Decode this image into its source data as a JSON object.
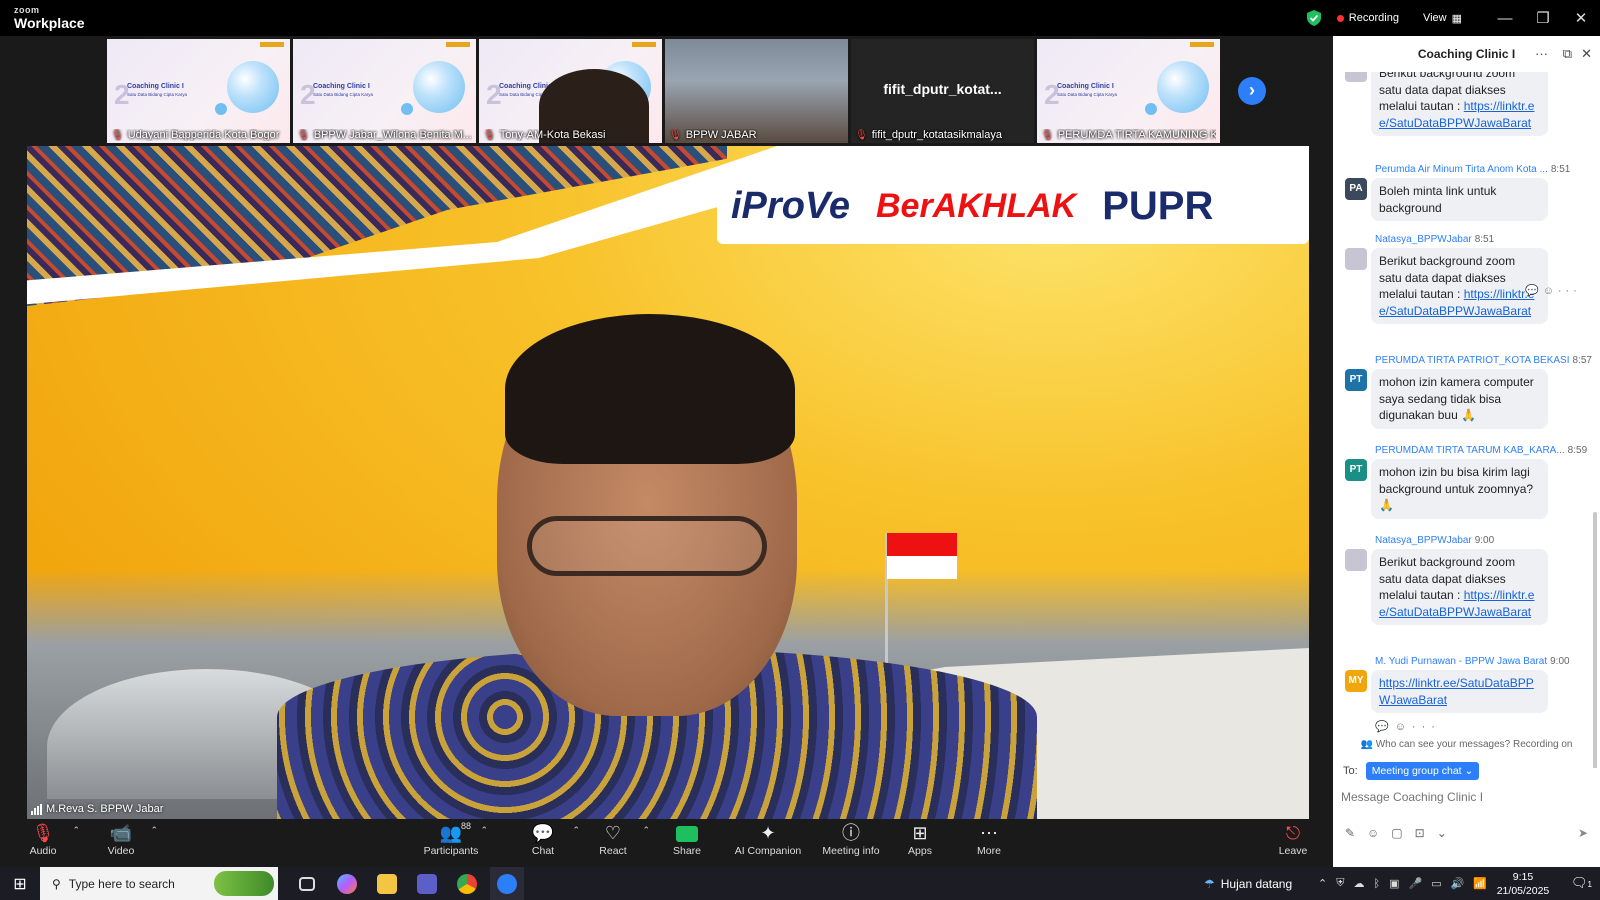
{
  "app": {
    "brand_top": "zoom",
    "brand": "Workplace",
    "recording_label": "Recording",
    "view_label": "View"
  },
  "thumbnails": [
    {
      "name": "Udayani Bapperida Kota Bogor",
      "type": "slide",
      "slide_title": "Coaching Clinic I",
      "slide_sub": "Satu Data Bidang Cipta Karya",
      "num": "2"
    },
    {
      "name": "BPPW Jabar_Wilona Benita M...",
      "type": "slide",
      "slide_title": "Coaching Clinic I",
      "slide_sub": "Satu Data Bidang Cipta Karya",
      "num": "2"
    },
    {
      "name": "Tony-AM-Kota Bekasi",
      "type": "person",
      "slide_title": "Coaching Clinic I",
      "slide_sub": "Satu Data Bidang Cipta Karya",
      "num": "2"
    },
    {
      "name": "BPPW JABAR",
      "type": "room"
    },
    {
      "name": "fifit_dputr_kotatasikmalaya",
      "type": "dark",
      "big": "fifit_dputr_kotat..."
    },
    {
      "name": "PERUMDA TIRTA KAMUNING KA...",
      "type": "slide",
      "slide_title": "Coaching Clinic I",
      "slide_sub": "Satu Data Bidang Cipta Karya",
      "num": "2"
    }
  ],
  "main_video": {
    "speaker_name": "M.Reva S. BPPW Jabar",
    "logo1": "iProVe",
    "logo2": "BerAKHLAK",
    "logo3": "PUPR"
  },
  "chat": {
    "title": "Coaching Clinic I",
    "messages": [
      {
        "sender": "",
        "time": "",
        "avatar": "",
        "text": "Berikut background zoom satu data dapat diakses melalui tautan :",
        "link": "https://linktr.ee/SatuDataBPPWJawaBarat"
      },
      {
        "sender": "Perumda Air Minum Tirta Anom Kota ...",
        "time": "8:51",
        "avatar": "PA",
        "text": "Boleh minta link untuk background",
        "link": ""
      },
      {
        "sender": "Natasya_BPPWJabar",
        "time": "8:51",
        "avatar": "",
        "text": "Berikut background zoom satu data dapat diakses melalui tautan :",
        "link": "https://linktr.ee/SatuDataBPPWJawaBarat"
      },
      {
        "sender": "PERUMDA TIRTA PATRIOT_KOTA BEKASI",
        "time": "8:57",
        "avatar": "PT",
        "text": "mohon izin kamera computer saya sedang tidak bisa digunakan buu 🙏",
        "link": ""
      },
      {
        "sender": "PERUMDAM TIRTA TARUM KAB_KARA...",
        "time": "8:59",
        "avatar": "PT",
        "text": "mohon izin bu bisa kirim lagi background untuk zoomnya? 🙏",
        "link": ""
      },
      {
        "sender": "Natasya_BPPWJabar",
        "time": "9:00",
        "avatar": "",
        "text": "Berikut background zoom satu data dapat diakses melalui tautan :",
        "link": "https://linktr.ee/SatuDataBPPWJawaBarat"
      },
      {
        "sender": "M. Yudi Purnawan - BPPW Jawa Barat",
        "time": "9:00",
        "avatar": "MY",
        "text": "",
        "link": "https://linktr.ee/SatuDataBPPWJawaBarat"
      }
    ],
    "who_can_see": "Who can see your messages? Recording on",
    "to_label": "To:",
    "to_value": "Meeting group chat",
    "input_placeholder": "Message Coaching Clinic I"
  },
  "toolbar": {
    "audio": "Audio",
    "video": "Video",
    "participants": "Participants",
    "participants_count": "88",
    "chat": "Chat",
    "react": "React",
    "share": "Share",
    "ai_companion": "AI Companion",
    "meeting_info": "Meeting info",
    "apps": "Apps",
    "more": "More",
    "leave": "Leave"
  },
  "taskbar": {
    "search_placeholder": "Type here to search",
    "weather": "Hujan datang",
    "time": "9:15",
    "date": "21/05/2025",
    "notif_count": "1"
  },
  "colors": {
    "accent": "#2d7ff9",
    "recording": "#ff3333",
    "share": "#1fbf5f",
    "brand_yellow": "#f5b617"
  }
}
